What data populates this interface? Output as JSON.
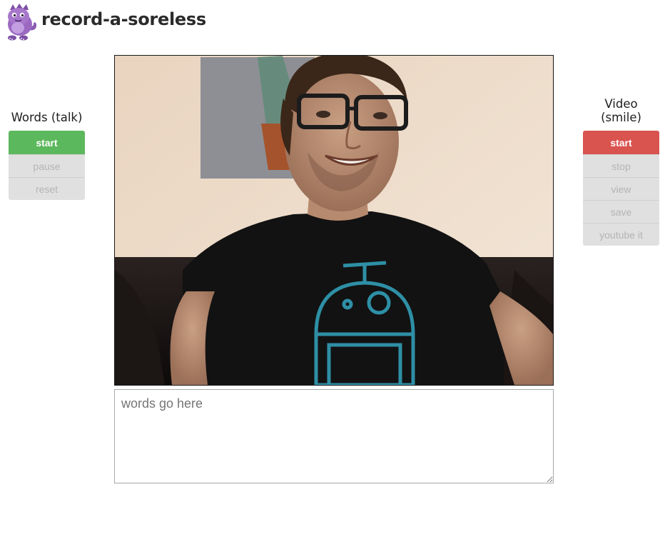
{
  "header": {
    "title": "record-a-soreless",
    "logo_icon": "purple-dinosaur-icon"
  },
  "words_panel": {
    "title": "Words (talk)",
    "buttons": [
      "start",
      "pause",
      "reset"
    ]
  },
  "video_panel": {
    "title_line1": "Video",
    "title_line2": "(smile)",
    "buttons": [
      "start",
      "stop",
      "view",
      "save",
      "youtube it"
    ]
  },
  "webcam": {
    "description_icon": "webcam-feed"
  },
  "words_input": {
    "value": "",
    "placeholder": "words go here"
  },
  "colors": {
    "start_green": "#5cb85c",
    "start_red": "#d9534f",
    "disabled_bg": "#e0e0e0",
    "disabled_text": "#b4b4b4"
  }
}
